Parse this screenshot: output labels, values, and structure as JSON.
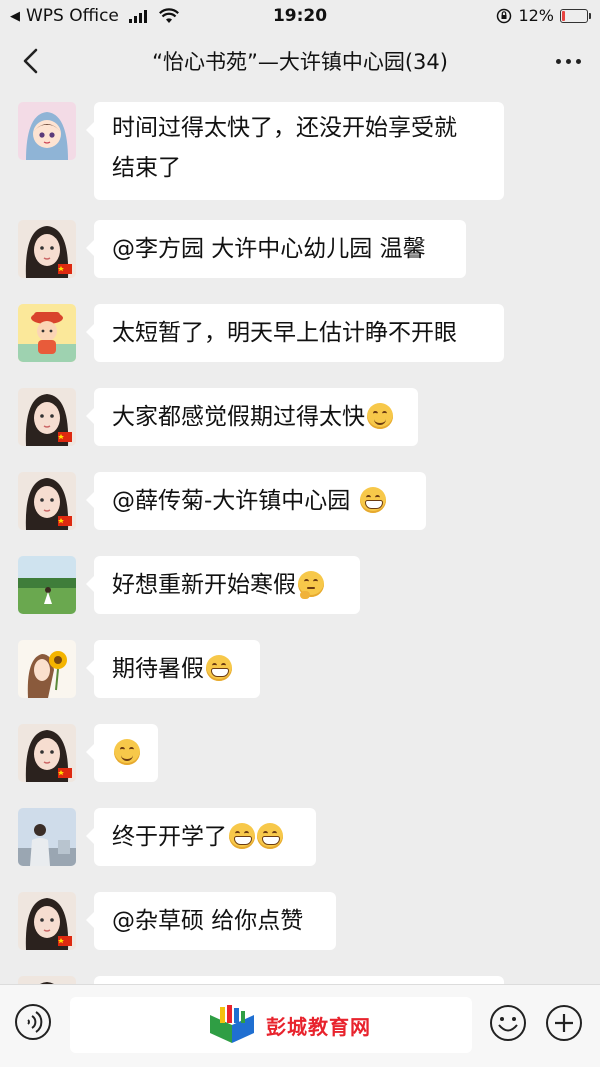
{
  "status_bar": {
    "carrier": "WPS Office",
    "time": "19:20",
    "battery_percent": "12%",
    "battery_level": 0.12,
    "battery_color": "#e64340"
  },
  "nav": {
    "title": "“怡心书苑”—大许镇中心园(34)",
    "back_icon": "chevron-left-icon",
    "more_icon": "more-dots-icon"
  },
  "messages": [
    {
      "avatar": "avatar-hooded-girl",
      "text": "时间过得太快了，还没开始享受就\n结束了",
      "emoji": []
    },
    {
      "avatar": "avatar-woman",
      "text": "@李方园 大许中心幼儿园 温馨",
      "emoji": []
    },
    {
      "avatar": "avatar-cartoon-guard",
      "text": "太短暂了，明天早上估计睁不开眼",
      "emoji": []
    },
    {
      "avatar": "avatar-woman",
      "text": "大家都感觉假期过得太快",
      "emoji": [
        "smile"
      ]
    },
    {
      "avatar": "avatar-woman",
      "text": "@薛传菊-大许镇中心园 ",
      "emoji": [
        "grin"
      ]
    },
    {
      "avatar": "avatar-field-girl",
      "text": "好想重新开始寒假",
      "emoji": [
        "think"
      ]
    },
    {
      "avatar": "avatar-sunflower-girl",
      "text": "期待暑假",
      "emoji": [
        "grin"
      ]
    },
    {
      "avatar": "avatar-woman",
      "text": "",
      "emoji": [
        "smile"
      ]
    },
    {
      "avatar": "avatar-man-outdoor",
      "text": "终于开学了",
      "emoji": [
        "grin",
        "grin"
      ]
    },
    {
      "avatar": "avatar-woman",
      "text": "@杂草硕 给你点赞",
      "emoji": []
    }
  ],
  "bottom_bar": {
    "voice_icon": "voice-icon",
    "emoji_icon": "emoji-icon",
    "plus_icon": "plus-icon",
    "watermark_text": "彭城教育网"
  }
}
